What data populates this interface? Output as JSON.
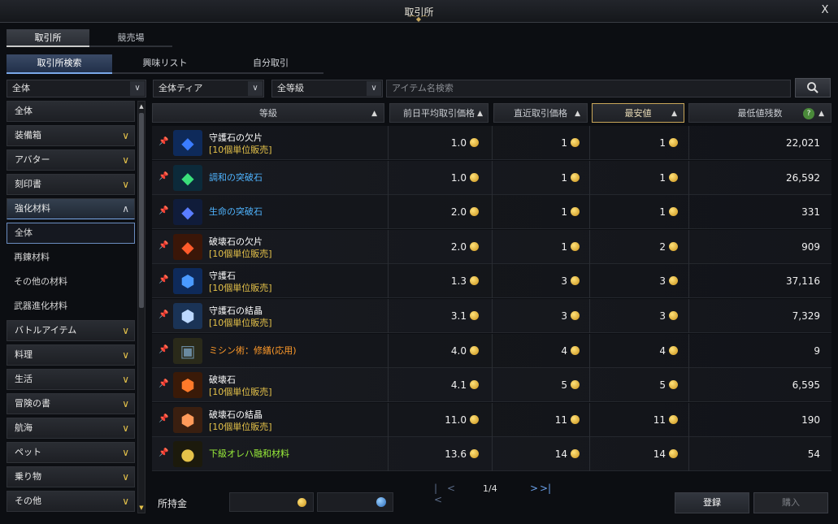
{
  "window": {
    "title": "取引所",
    "close_label": "X"
  },
  "tabs_primary": [
    {
      "label": "取引所",
      "active": true
    },
    {
      "label": "競売場",
      "active": false
    }
  ],
  "tabs_secondary": [
    {
      "label": "取引所検索",
      "active": true
    },
    {
      "label": "興味リスト",
      "active": false
    },
    {
      "label": "自分取引",
      "active": false
    }
  ],
  "filters": {
    "category": "全体",
    "tier": "全体ティア",
    "grade": "全等級",
    "search_placeholder": "アイテム名検索"
  },
  "sidebar": [
    {
      "label": "全体",
      "type": "cat",
      "chevron": ""
    },
    {
      "label": "装備箱",
      "type": "cat",
      "chevron": "∨"
    },
    {
      "label": "アバター",
      "type": "cat",
      "chevron": "∨"
    },
    {
      "label": "刻印書",
      "type": "cat",
      "chevron": "∨"
    },
    {
      "label": "強化材料",
      "type": "cat-open",
      "chevron": "∧"
    },
    {
      "label": "全体",
      "type": "sub-selected",
      "chevron": ""
    },
    {
      "label": "再錬材料",
      "type": "sub",
      "chevron": ""
    },
    {
      "label": "その他の材料",
      "type": "sub",
      "chevron": ""
    },
    {
      "label": "武器進化材料",
      "type": "sub",
      "chevron": ""
    },
    {
      "label": "バトルアイテム",
      "type": "cat",
      "chevron": "∨"
    },
    {
      "label": "料理",
      "type": "cat",
      "chevron": "∨"
    },
    {
      "label": "生活",
      "type": "cat",
      "chevron": "∨"
    },
    {
      "label": "冒険の書",
      "type": "cat",
      "chevron": "∨"
    },
    {
      "label": "航海",
      "type": "cat",
      "chevron": "∨"
    },
    {
      "label": "ペット",
      "type": "cat",
      "chevron": "∨"
    },
    {
      "label": "乗り物",
      "type": "cat",
      "chevron": "∨"
    },
    {
      "label": "その他",
      "type": "cat",
      "chevron": "∨"
    }
  ],
  "table": {
    "headers": {
      "grade": "等級",
      "avg": "前日平均取引価格",
      "recent": "直近取引価格",
      "lowest": "最安値",
      "stock": "最低値残数"
    },
    "help_label": "?",
    "rows": [
      {
        "name": "守護石の欠片",
        "bundle": "[10個単位販売]",
        "color": "#ffffff",
        "icon": "◆",
        "icon_color": "#3a7cff",
        "icon_bg": "#0e2a5a",
        "avg": "1.0",
        "recent": "1",
        "lowest": "1",
        "stock": "22,021"
      },
      {
        "name": "調和の突破石",
        "bundle": "",
        "color": "#4fb4ff",
        "icon": "◆",
        "icon_color": "#3adf7a",
        "icon_bg": "#0c2a3a",
        "avg": "1.0",
        "recent": "1",
        "lowest": "1",
        "stock": "26,592"
      },
      {
        "name": "生命の突破石",
        "bundle": "",
        "color": "#4fb4ff",
        "icon": "◆",
        "icon_color": "#5a7dff",
        "icon_bg": "#101c3a",
        "avg": "2.0",
        "recent": "1",
        "lowest": "1",
        "stock": "331"
      },
      {
        "name": "破壊石の欠片",
        "bundle": "[10個単位販売]",
        "color": "#ffffff",
        "icon": "◆",
        "icon_color": "#ff5a2a",
        "icon_bg": "#3a1608",
        "avg": "2.0",
        "recent": "1",
        "lowest": "2",
        "stock": "909"
      },
      {
        "name": "守護石",
        "bundle": "[10個単位販売]",
        "color": "#ffffff",
        "icon": "⬢",
        "icon_color": "#4a9aff",
        "icon_bg": "#0e2a5a",
        "avg": "1.3",
        "recent": "3",
        "lowest": "3",
        "stock": "37,116"
      },
      {
        "name": "守護石の結晶",
        "bundle": "[10個単位販売]",
        "color": "#ffffff",
        "icon": "⬢",
        "icon_color": "#bcd8ff",
        "icon_bg": "#1a3356",
        "avg": "3.1",
        "recent": "3",
        "lowest": "3",
        "stock": "7,329"
      },
      {
        "name": "ミシン術：修繕(応用)",
        "bundle": "",
        "color": "#ff9a2a",
        "icon": "▣",
        "icon_color": "#6a8aa0",
        "icon_bg": "#2a2a1a",
        "avg": "4.0",
        "recent": "4",
        "lowest": "4",
        "stock": "9"
      },
      {
        "name": "破壊石",
        "bundle": "[10個単位販売]",
        "color": "#ffffff",
        "icon": "⬢",
        "icon_color": "#ff7a2a",
        "icon_bg": "#3a1a08",
        "avg": "4.1",
        "recent": "5",
        "lowest": "5",
        "stock": "6,595"
      },
      {
        "name": "破壊石の結晶",
        "bundle": "[10個単位販売]",
        "color": "#ffffff",
        "icon": "⬢",
        "icon_color": "#ff9a5a",
        "icon_bg": "#3a1f10",
        "avg": "11.0",
        "recent": "11",
        "lowest": "11",
        "stock": "190"
      },
      {
        "name": "下級オレハ融和材料",
        "bundle": "",
        "color": "#9aef3a",
        "icon": "●",
        "icon_color": "#e6c34a",
        "icon_bg": "#1c1a0c",
        "avg": "13.6",
        "recent": "14",
        "lowest": "14",
        "stock": "54"
      }
    ]
  },
  "pager": {
    "first": "|<",
    "prev": "<",
    "page": "1/4",
    "next": ">",
    "last": ">|"
  },
  "footer": {
    "money_label": "所持金",
    "register": "登録",
    "buy": "購入"
  },
  "colors": {
    "accent_gold": "#c9a75a",
    "accent_blue": "#7aa8e8",
    "coin": "#e6c34a"
  }
}
